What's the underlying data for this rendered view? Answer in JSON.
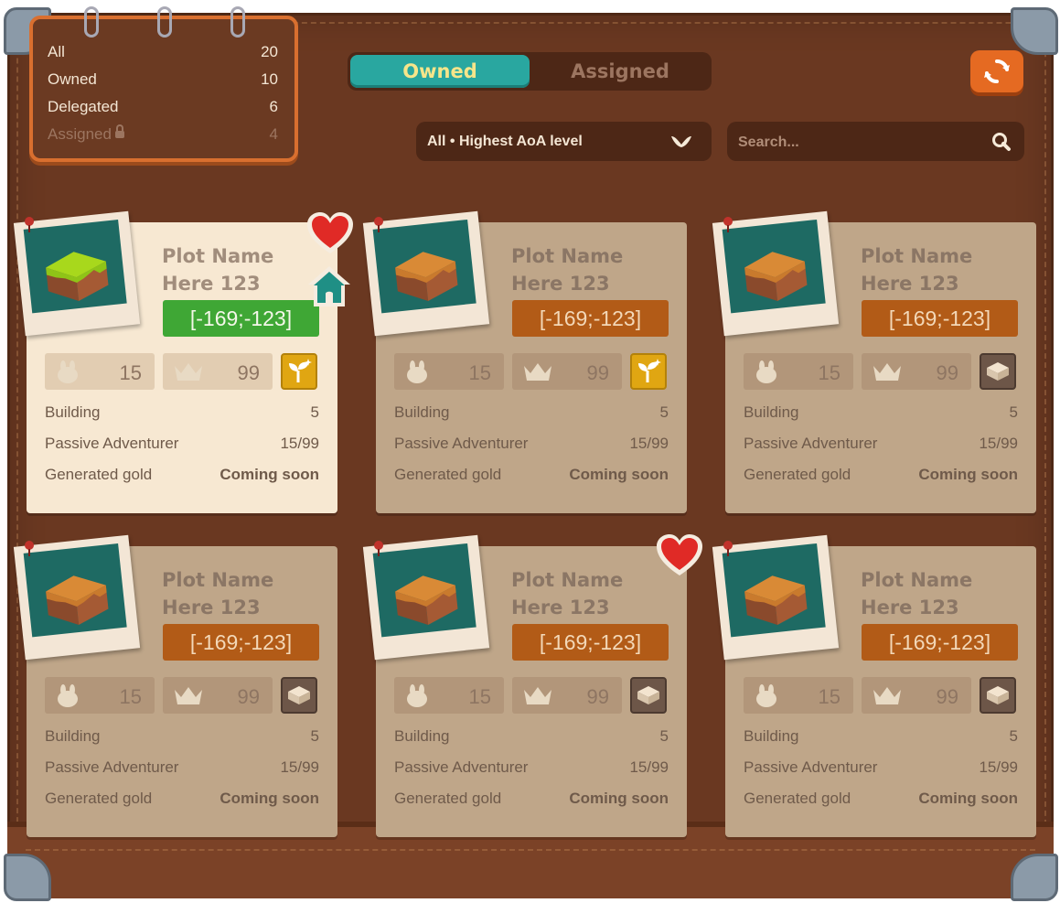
{
  "summary": {
    "rows": [
      {
        "label": "All",
        "count": "20"
      },
      {
        "label": "Owned",
        "count": "10"
      },
      {
        "label": "Delegated",
        "count": "6"
      },
      {
        "label": "Assigned",
        "count": "4"
      }
    ]
  },
  "tabs": {
    "owned": "Owned",
    "assigned": "Assigned",
    "active": "Owned"
  },
  "filter": {
    "selected": "All • Highest AoA level"
  },
  "search": {
    "placeholder": "Search..."
  },
  "colors": {
    "accent_teal": "#29a7a0",
    "orange": "#e56a22",
    "selected_card": "#f7e8d2",
    "card": "#bfa689",
    "coords_green": "#3fa735",
    "coords_orange": "#b25b17"
  },
  "cards": [
    {
      "name_line1": "Plot Name",
      "name_line2": "Here 123",
      "coords": "[-169;-123]",
      "stat1": "15",
      "stat2": "99",
      "badge": "sprout-icon",
      "building_label": "Building",
      "building_value": "5",
      "adventurer_label": "Passive Adventurer",
      "adventurer_value": "15/99",
      "gold_label": "Generated gold",
      "gold_value": "Coming soon",
      "favorite": true,
      "home": true,
      "selected": true
    },
    {
      "name_line1": "Plot Name",
      "name_line2": "Here 123",
      "coords": "[-169;-123]",
      "stat1": "15",
      "stat2": "99",
      "badge": "sprout-icon",
      "building_label": "Building",
      "building_value": "5",
      "adventurer_label": "Passive Adventurer",
      "adventurer_value": "15/99",
      "gold_label": "Generated gold",
      "gold_value": "Coming soon",
      "favorite": false,
      "home": false,
      "selected": false
    },
    {
      "name_line1": "Plot Name",
      "name_line2": "Here 123",
      "coords": "[-169;-123]",
      "stat1": "15",
      "stat2": "99",
      "badge": "chest-icon",
      "building_label": "Building",
      "building_value": "5",
      "adventurer_label": "Passive Adventurer",
      "adventurer_value": "15/99",
      "gold_label": "Generated gold",
      "gold_value": "Coming soon",
      "favorite": false,
      "home": false,
      "selected": false
    },
    {
      "name_line1": "Plot Name",
      "name_line2": "Here 123",
      "coords": "[-169;-123]",
      "stat1": "15",
      "stat2": "99",
      "badge": "chest-icon",
      "building_label": "Building",
      "building_value": "5",
      "adventurer_label": "Passive Adventurer",
      "adventurer_value": "15/99",
      "gold_label": "Generated gold",
      "gold_value": "Coming soon",
      "favorite": false,
      "home": false,
      "selected": false
    },
    {
      "name_line1": "Plot Name",
      "name_line2": "Here 123",
      "coords": "[-169;-123]",
      "stat1": "15",
      "stat2": "99",
      "badge": "chest-icon",
      "building_label": "Building",
      "building_value": "5",
      "adventurer_label": "Passive Adventurer",
      "adventurer_value": "15/99",
      "gold_label": "Generated gold",
      "gold_value": "Coming soon",
      "favorite": true,
      "home": false,
      "selected": false
    },
    {
      "name_line1": "Plot Name",
      "name_line2": "Here 123",
      "coords": "[-169;-123]",
      "stat1": "15",
      "stat2": "99",
      "badge": "chest-icon",
      "building_label": "Building",
      "building_value": "5",
      "adventurer_label": "Passive Adventurer",
      "adventurer_value": "15/99",
      "gold_label": "Generated gold",
      "gold_value": "Coming soon",
      "favorite": false,
      "home": false,
      "selected": false
    }
  ]
}
